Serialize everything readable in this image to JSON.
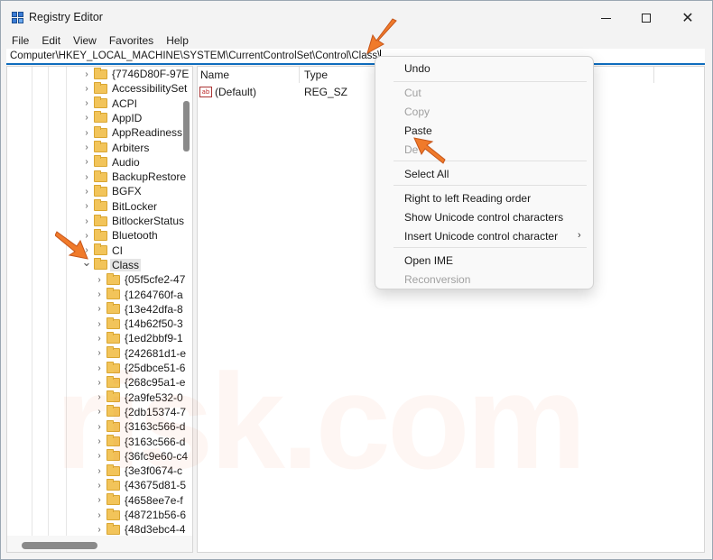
{
  "window": {
    "title": "Registry Editor",
    "minimize": "minimize",
    "maximize": "maximize",
    "close": "✕"
  },
  "menu": [
    "File",
    "Edit",
    "View",
    "Favorites",
    "Help"
  ],
  "address": {
    "value": "Computer\\HKEY_LOCAL_MACHINE\\SYSTEM\\CurrentControlSet\\Control\\Class\\"
  },
  "tree": {
    "items": [
      {
        "label": "{7746D80F-97E",
        "expanded": false
      },
      {
        "label": "AccessibilitySet",
        "expanded": false
      },
      {
        "label": "ACPI",
        "expanded": false
      },
      {
        "label": "AppID",
        "expanded": false
      },
      {
        "label": "AppReadiness",
        "expanded": false
      },
      {
        "label": "Arbiters",
        "expanded": false
      },
      {
        "label": "Audio",
        "expanded": false
      },
      {
        "label": "BackupRestore",
        "expanded": false
      },
      {
        "label": "BGFX",
        "expanded": false
      },
      {
        "label": "BitLocker",
        "expanded": false
      },
      {
        "label": "BitlockerStatus",
        "expanded": false
      },
      {
        "label": "Bluetooth",
        "expanded": false
      },
      {
        "label": "CI",
        "expanded": false
      },
      {
        "label": "Class",
        "expanded": true
      }
    ],
    "children": [
      "{05f5cfe2-47",
      "{1264760f-a",
      "{13e42dfa-8",
      "{14b62f50-3",
      "{1ed2bbf9-1",
      "{242681d1-e",
      "{25dbce51-6",
      "{268c95a1-e",
      "{2a9fe532-0",
      "{2db15374-7",
      "{3163c566-d",
      "{3163c566-d",
      "{36fc9e60-c4",
      "{3e3f0674-c",
      "{43675d81-5",
      "{4658ee7e-f",
      "{48721b56-6",
      "{48d3ebc4-4"
    ]
  },
  "values": {
    "columns": {
      "name": "Name",
      "type": "Type"
    },
    "rows": [
      {
        "name": "(Default)",
        "type": "REG_SZ",
        "icon": "ab-icon"
      }
    ]
  },
  "context_menu": {
    "items": [
      {
        "label": "Undo",
        "enabled": true
      },
      {
        "label": "Cut",
        "enabled": false
      },
      {
        "label": "Copy",
        "enabled": false
      },
      {
        "label": "Paste",
        "enabled": true
      },
      {
        "label": "De",
        "enabled": false
      },
      {
        "label": "Select All",
        "enabled": true
      },
      {
        "label": "Right to left Reading order",
        "enabled": true
      },
      {
        "label": "Show Unicode control characters",
        "enabled": true
      },
      {
        "label": "Insert Unicode control character",
        "enabled": true,
        "submenu": true
      },
      {
        "label": "Open IME",
        "enabled": true
      },
      {
        "label": "Reconversion",
        "enabled": false
      }
    ],
    "submenu_arrow": "›"
  },
  "colors": {
    "accent": "#0f6cbd",
    "annotation_arrow": "#f07a2a",
    "folder": "#f2c45a"
  }
}
